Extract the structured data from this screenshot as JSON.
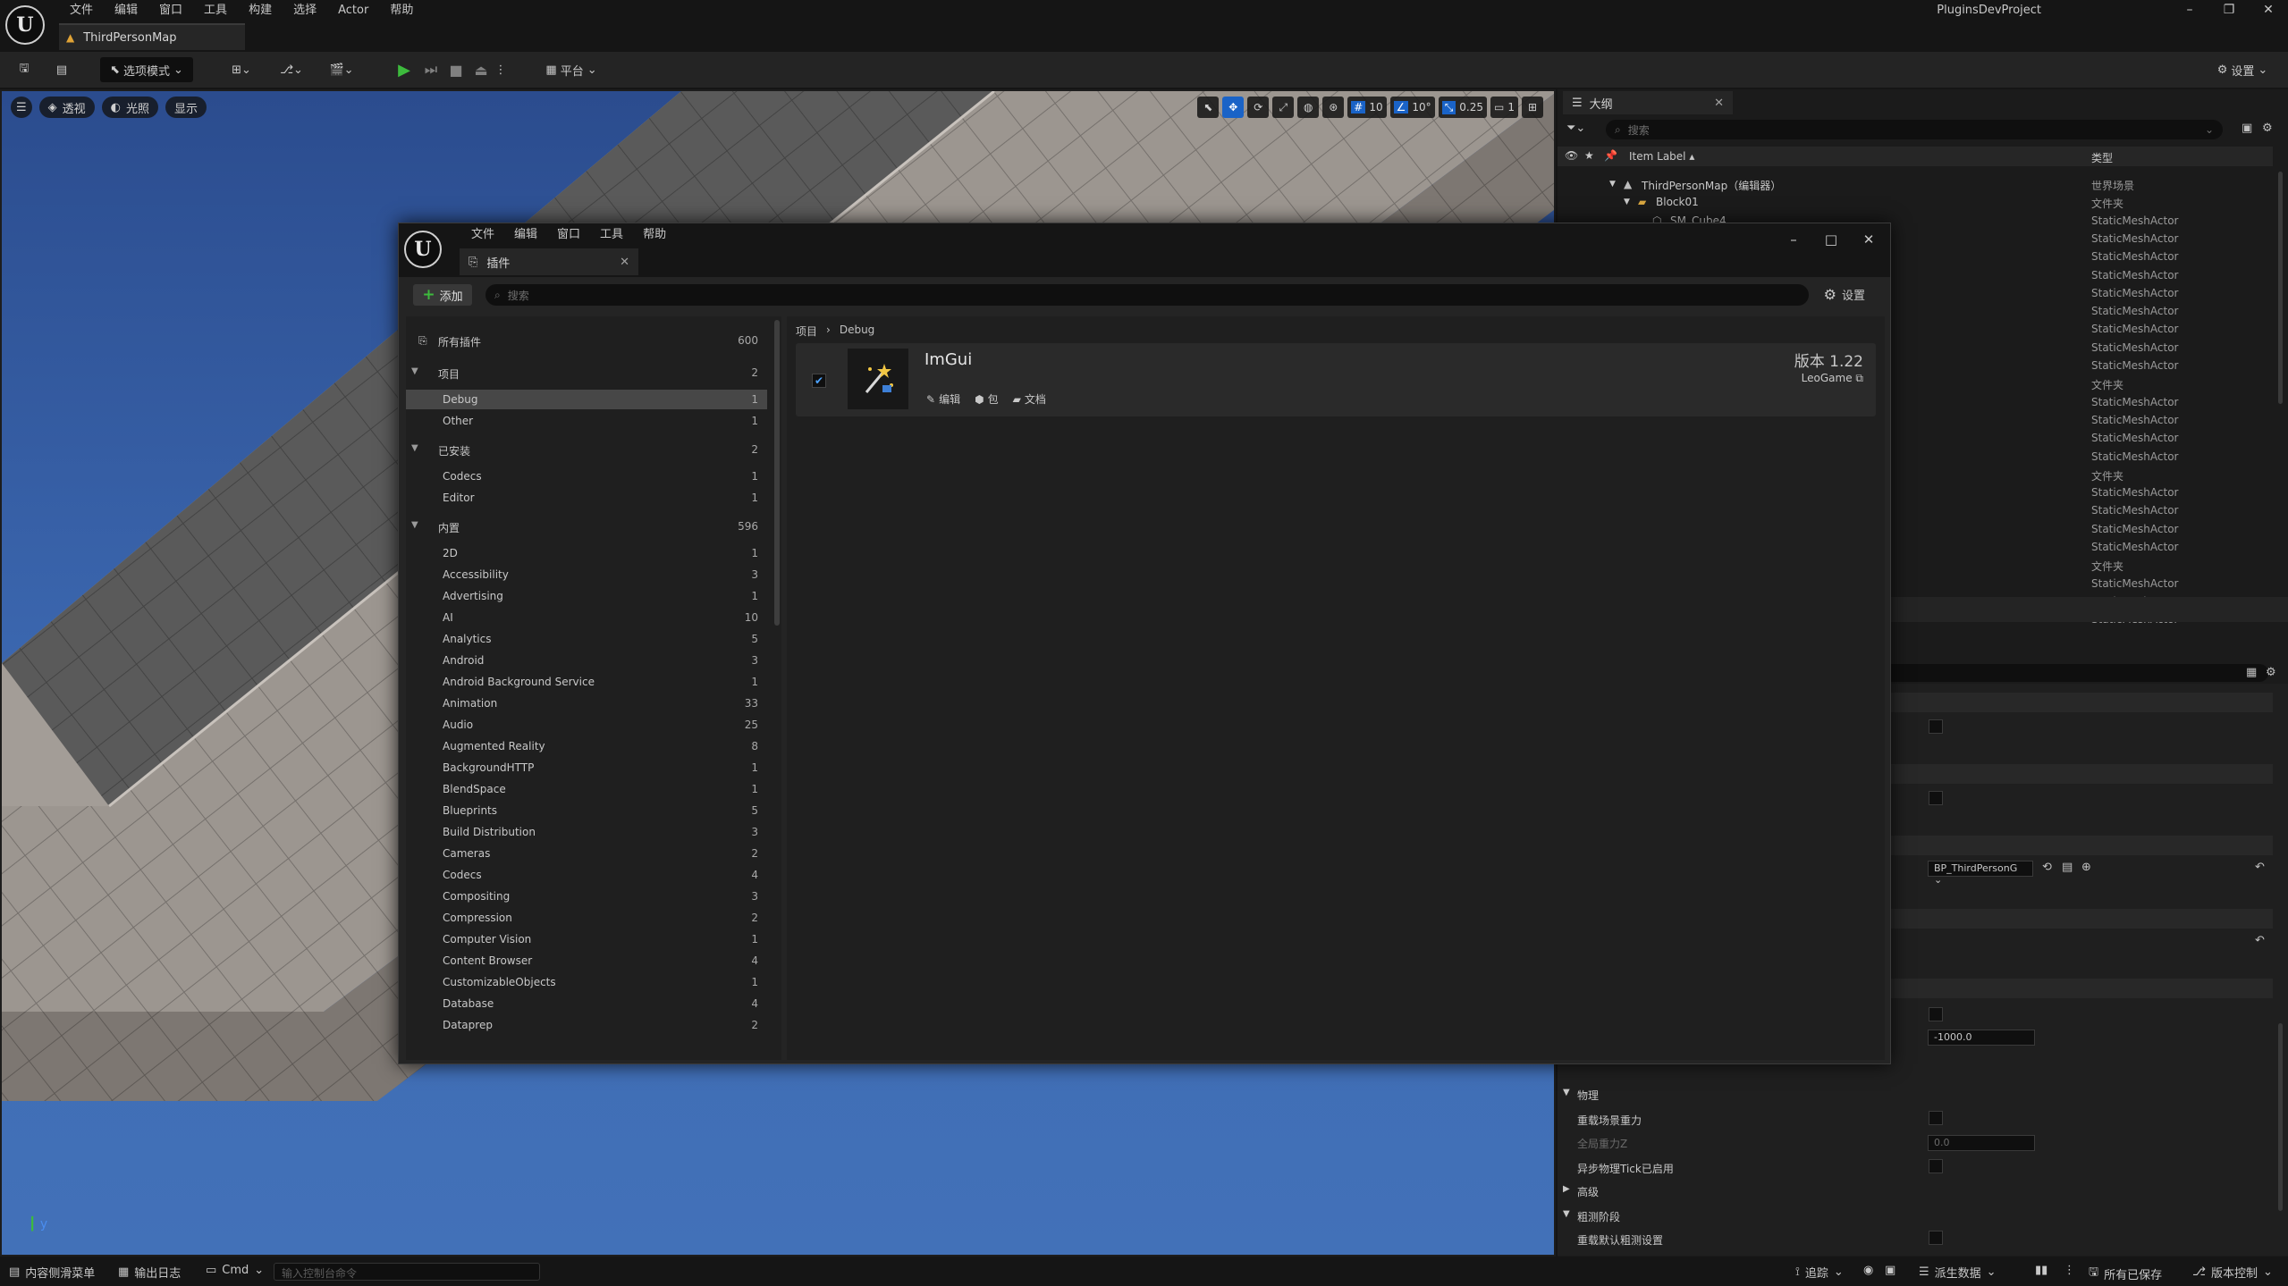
{
  "editor": {
    "menu": [
      "文件",
      "编辑",
      "窗口",
      "工具",
      "构建",
      "选择",
      "Actor",
      "帮助"
    ],
    "doc_tab": "ThirdPersonMap",
    "project": "PluginsDevProject",
    "toolbar": {
      "mode": "选项模式",
      "platform": "平台",
      "settings": "设置"
    }
  },
  "viewport": {
    "perspective": "透视",
    "lighting": "光照",
    "show": "显示",
    "grid_snap": "10",
    "rotation_snap": "10°",
    "scale_snap": "0.25",
    "camera_speed": "1"
  },
  "outliner": {
    "tab": "大纲",
    "search_placeholder": "搜索",
    "col_label": "Item Label",
    "col_type": "类型",
    "rows": [
      {
        "name": "ThirdPersonMap（编辑器）",
        "type": "世界场景"
      },
      {
        "name": "Block01",
        "type": "文件夹"
      },
      {
        "name": "SM_Cube4",
        "type": "StaticMeshActor"
      },
      {
        "name": "",
        "type": "StaticMeshActor"
      },
      {
        "name": "",
        "type": "StaticMeshActor"
      },
      {
        "name": "",
        "type": "StaticMeshActor"
      },
      {
        "name": "",
        "type": "StaticMeshActor"
      },
      {
        "name": "",
        "type": "StaticMeshActor"
      },
      {
        "name": "",
        "type": "StaticMeshActor"
      },
      {
        "name": "",
        "type": "StaticMeshActor"
      },
      {
        "name": "",
        "type": "StaticMeshActor"
      },
      {
        "name": "",
        "type": "文件夹"
      },
      {
        "name": "",
        "type": "StaticMeshActor"
      },
      {
        "name": "",
        "type": "StaticMeshActor"
      },
      {
        "name": "",
        "type": "StaticMeshActor"
      },
      {
        "name": "",
        "type": "StaticMeshActor"
      },
      {
        "name": "",
        "type": "文件夹"
      },
      {
        "name": "",
        "type": "StaticMeshActor"
      },
      {
        "name": "",
        "type": "StaticMeshActor"
      },
      {
        "name": "",
        "type": "StaticMeshActor"
      },
      {
        "name": "",
        "type": "StaticMeshActor"
      },
      {
        "name": "",
        "type": "文件夹"
      },
      {
        "name": "",
        "type": "StaticMeshActor"
      },
      {
        "name": "",
        "type": "StaticMeshActor"
      },
      {
        "name": "",
        "type": "StaticMeshActor"
      }
    ]
  },
  "details": {
    "gamemode_value": "BP_ThirdPersonG",
    "kill_z_value": "-1000.0",
    "section_physics": "物理",
    "override_gravity": "重载场景重力",
    "global_gravity": "全局重力Z",
    "global_gravity_value": "0.0",
    "async_physics": "异步物理Tick已启用",
    "section_advanced": "高级",
    "section_precompute": "粗测阶段",
    "override_precompute": "重载默认粗测设置"
  },
  "statusbar": {
    "content_drawer": "内容侧滑菜单",
    "output_log": "输出日志",
    "cmd": "Cmd",
    "console_placeholder": "输入控制台命令",
    "trace": "追踪",
    "derived_data": "派生数据",
    "all_saved": "所有已保存",
    "source_control": "版本控制"
  },
  "plugins": {
    "menu": [
      "文件",
      "编辑",
      "窗口",
      "工具",
      "帮助"
    ],
    "tab": "插件",
    "add": "添加",
    "search_placeholder": "搜索",
    "settings": "设置",
    "categories": [
      {
        "label": "所有插件",
        "count": "600",
        "level": 0,
        "icon": true
      },
      {
        "label": "项目",
        "count": "2",
        "level": 1,
        "arrow": true
      },
      {
        "label": "Debug",
        "count": "1",
        "level": 2,
        "selected": true
      },
      {
        "label": "Other",
        "count": "1",
        "level": 2
      },
      {
        "label": "已安装",
        "count": "2",
        "level": 1,
        "arrow": true
      },
      {
        "label": "Codecs",
        "count": "1",
        "level": 2
      },
      {
        "label": "Editor",
        "count": "1",
        "level": 2
      },
      {
        "label": "内置",
        "count": "596",
        "level": 1,
        "arrow": true
      },
      {
        "label": "2D",
        "count": "1",
        "level": 2
      },
      {
        "label": "Accessibility",
        "count": "3",
        "level": 2
      },
      {
        "label": "Advertising",
        "count": "1",
        "level": 2
      },
      {
        "label": "AI",
        "count": "10",
        "level": 2
      },
      {
        "label": "Analytics",
        "count": "5",
        "level": 2
      },
      {
        "label": "Android",
        "count": "3",
        "level": 2
      },
      {
        "label": "Android Background Service",
        "count": "1",
        "level": 2
      },
      {
        "label": "Animation",
        "count": "33",
        "level": 2
      },
      {
        "label": "Audio",
        "count": "25",
        "level": 2
      },
      {
        "label": "Augmented Reality",
        "count": "8",
        "level": 2
      },
      {
        "label": "BackgroundHTTP",
        "count": "1",
        "level": 2
      },
      {
        "label": "BlendSpace",
        "count": "1",
        "level": 2
      },
      {
        "label": "Blueprints",
        "count": "5",
        "level": 2
      },
      {
        "label": "Build Distribution",
        "count": "3",
        "level": 2
      },
      {
        "label": "Cameras",
        "count": "2",
        "level": 2
      },
      {
        "label": "Codecs",
        "count": "4",
        "level": 2
      },
      {
        "label": "Compositing",
        "count": "3",
        "level": 2
      },
      {
        "label": "Compression",
        "count": "2",
        "level": 2
      },
      {
        "label": "Computer Vision",
        "count": "1",
        "level": 2
      },
      {
        "label": "Content Browser",
        "count": "4",
        "level": 2
      },
      {
        "label": "CustomizableObjects",
        "count": "1",
        "level": 2
      },
      {
        "label": "Database",
        "count": "4",
        "level": 2
      },
      {
        "label": "Dataprep",
        "count": "2",
        "level": 2
      }
    ],
    "breadcrumb": [
      "项目",
      "Debug"
    ],
    "plugin": {
      "name": "ImGui",
      "version": "版本 1.22",
      "author": "LeoGame",
      "edit": "编辑",
      "package": "包",
      "docs": "文档",
      "enabled": true
    }
  }
}
